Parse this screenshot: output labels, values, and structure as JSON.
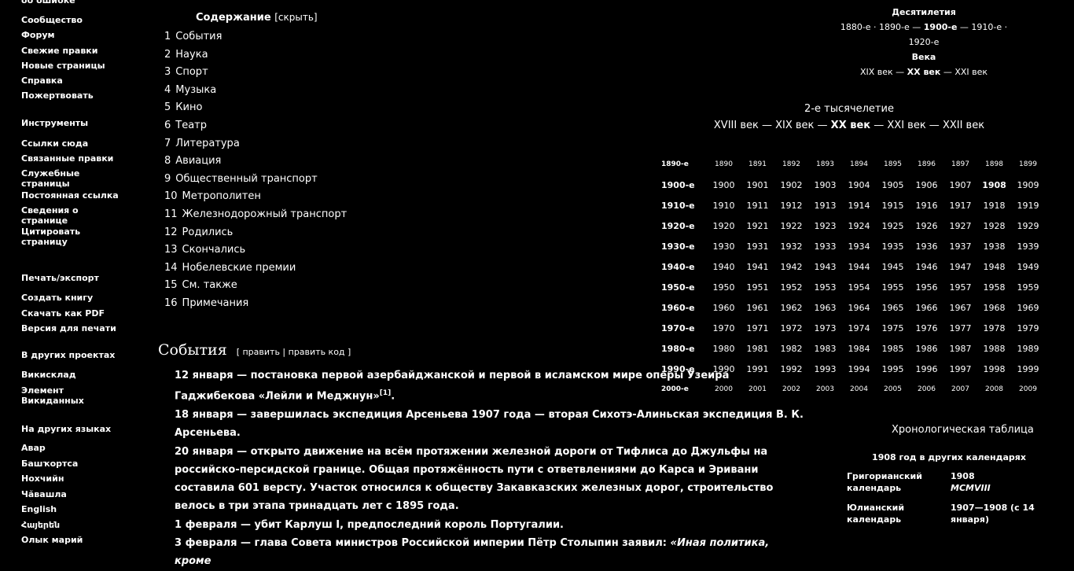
{
  "sidebar": {
    "nav_items": [
      "об ошибке",
      "Сообщество",
      "Форум",
      "Свежие правки",
      "Новые страницы",
      "Справка",
      "Пожертвовать"
    ],
    "tools_heading": "Инструменты",
    "tools_items": [
      "Ссылки сюда",
      "Связанные правки",
      "Служебные страницы",
      "Постоянная ссылка",
      "Сведения о странице",
      "Цитировать страницу"
    ],
    "print_heading": "Печать/экспорт",
    "print_items": [
      "Создать книгу",
      "Скачать как PDF",
      "Версия для печати"
    ],
    "projects_heading": "В других проектах",
    "projects_items": [
      "Викисклад",
      "Элемент Викиданных"
    ],
    "langs_heading": "На других языках",
    "langs_items": [
      "Авар",
      "Башҡортса",
      "Нохчийн",
      "Чӑвашла",
      "English",
      "Հայերեն",
      "Олык марий"
    ]
  },
  "toc": {
    "title": "Содержание",
    "toggle": "[скрыть]",
    "items": [
      {
        "num": "1",
        "label": "События"
      },
      {
        "num": "2",
        "label": "Наука"
      },
      {
        "num": "3",
        "label": "Спорт"
      },
      {
        "num": "4",
        "label": "Музыка"
      },
      {
        "num": "5",
        "label": "Кино"
      },
      {
        "num": "6",
        "label": "Театр"
      },
      {
        "num": "7",
        "label": "Литература"
      },
      {
        "num": "8",
        "label": "Авиация"
      },
      {
        "num": "9",
        "label": "Общественный транспорт"
      },
      {
        "num": "10",
        "label": "Метрополитен"
      },
      {
        "num": "11",
        "label": "Железнодорожный транспорт"
      },
      {
        "num": "12",
        "label": "Родились"
      },
      {
        "num": "13",
        "label": "Скончались"
      },
      {
        "num": "14",
        "label": "Нобелевские премии"
      },
      {
        "num": "15",
        "label": "См. также"
      },
      {
        "num": "16",
        "label": "Примечания"
      }
    ]
  },
  "section": {
    "title": "События",
    "edit": "[ править | править код ]"
  },
  "events": {
    "e1_date": "12 января",
    "e1_text": " — постановка первой азербайджанской и первой в исламском мире оперы Узеира Гаджибекова «Лейли и Меджнун»",
    "e1_ref": "[1]",
    "e1_end": ".",
    "e2_date": "18 января",
    "e2_text": " — завершилась экспедиция Арсеньева 1907 года — вторая Сихотэ-Алиньская экспедиция В. К. Арсеньева.",
    "e3_date": "20 января",
    "e3_text": " — открыто движение на всём протяжении железной дороги от Тифлиса до Джульфы на российско-персидской границе. Общая протяжённость пути с ответвлениями до Карса и Эривани составила 601 версту. Участок относился к обществу Закавказских железных дорог, строительство велось в три этапа тринадцать лет с 1895 года.",
    "e4_date": "1 февраля",
    "e4_text": " — убит Карлуш I, предпоследний король Португалии.",
    "e5_date": "3 февраля",
    "e5_text": " — глава Совета министров Российской империи Пётр Столыпин заявил: ",
    "e5_quote": "«Иная политика, кроме"
  },
  "nav_right": {
    "decades_heading": "Десятилетия",
    "decades_line1": "1880-е · 1890-е — ",
    "decades_current": "1900-е",
    "decades_line1b": " — 1910-е ·",
    "decades_line2": "1920-е",
    "centuries_heading": "Века",
    "centuries_a": "XIX век — ",
    "centuries_current": "XX век",
    "centuries_b": " — XXI век"
  },
  "millennium": {
    "title": "2-е тысячелетие",
    "centuries_a": "XVIII век — XIX век — ",
    "centuries_current": "XX век",
    "centuries_b": " — XXI век — XXII век"
  },
  "decades_grid": [
    {
      "dec": "1890-е",
      "years": [
        "1890",
        "1891",
        "1892",
        "1893",
        "1894",
        "1895",
        "1896",
        "1897",
        "1898",
        "1899"
      ],
      "small": true
    },
    {
      "dec": "1900-е",
      "years": [
        "1900",
        "1901",
        "1902",
        "1903",
        "1904",
        "1905",
        "1906",
        "1907",
        "1908",
        "1909"
      ],
      "small": false
    },
    {
      "dec": "1910-е",
      "years": [
        "1910",
        "1911",
        "1912",
        "1913",
        "1914",
        "1915",
        "1916",
        "1917",
        "1918",
        "1919"
      ],
      "small": false
    },
    {
      "dec": "1920-е",
      "years": [
        "1920",
        "1921",
        "1922",
        "1923",
        "1924",
        "1925",
        "1926",
        "1927",
        "1928",
        "1929"
      ],
      "small": false
    },
    {
      "dec": "1930-е",
      "years": [
        "1930",
        "1931",
        "1932",
        "1933",
        "1934",
        "1935",
        "1936",
        "1937",
        "1938",
        "1939"
      ],
      "small": false
    },
    {
      "dec": "1940-е",
      "years": [
        "1940",
        "1941",
        "1942",
        "1943",
        "1944",
        "1945",
        "1946",
        "1947",
        "1948",
        "1949"
      ],
      "small": false
    },
    {
      "dec": "1950-е",
      "years": [
        "1950",
        "1951",
        "1952",
        "1953",
        "1954",
        "1955",
        "1956",
        "1957",
        "1958",
        "1959"
      ],
      "small": false
    },
    {
      "dec": "1960-е",
      "years": [
        "1960",
        "1961",
        "1962",
        "1963",
        "1964",
        "1965",
        "1966",
        "1967",
        "1968",
        "1969"
      ],
      "small": false
    },
    {
      "dec": "1970-е",
      "years": [
        "1970",
        "1971",
        "1972",
        "1973",
        "1974",
        "1975",
        "1976",
        "1977",
        "1978",
        "1979"
      ],
      "small": false
    },
    {
      "dec": "1980-е",
      "years": [
        "1980",
        "1981",
        "1982",
        "1983",
        "1984",
        "1985",
        "1986",
        "1987",
        "1988",
        "1989"
      ],
      "small": false
    },
    {
      "dec": "1990-е",
      "years": [
        "1990",
        "1991",
        "1992",
        "1993",
        "1994",
        "1995",
        "1996",
        "1997",
        "1998",
        "1999"
      ],
      "small": false
    },
    {
      "dec": "2000-е",
      "years": [
        "2000",
        "2001",
        "2002",
        "2003",
        "2004",
        "2005",
        "2006",
        "2007",
        "2008",
        "2009"
      ],
      "small": true
    }
  ],
  "chron_title": "Хронологическая таблица",
  "calendars": {
    "caption": "1908 год в других календарях",
    "rows": [
      {
        "name": "Григорианский календарь",
        "value": "1908",
        "value2": "MCMVIII"
      },
      {
        "name": "Юлианский календарь",
        "value": "1907—1908 (с 14 января)",
        "value2": ""
      }
    ]
  }
}
